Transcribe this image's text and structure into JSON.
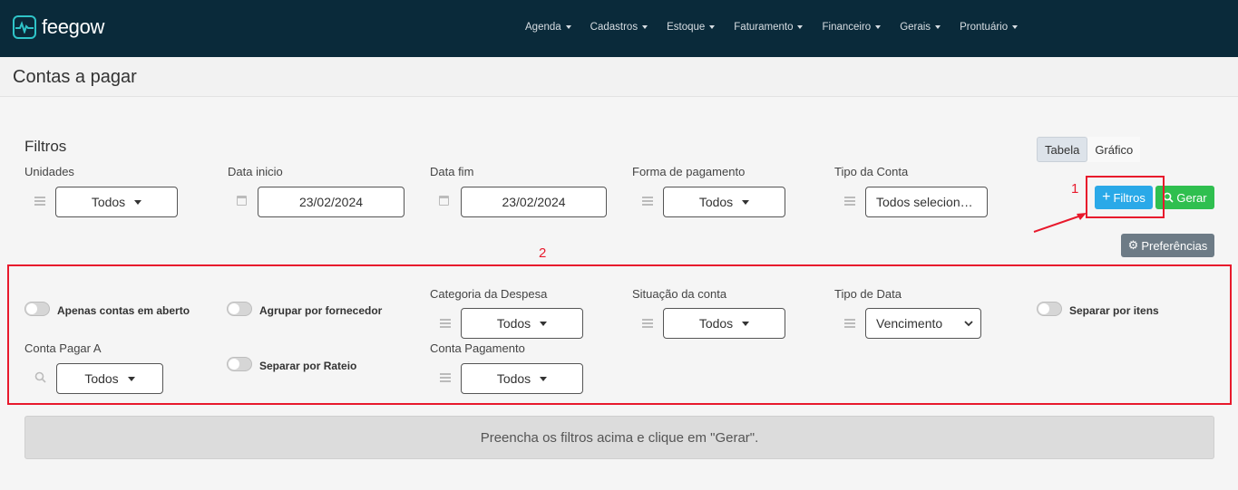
{
  "app": {
    "logo_text": "feegow"
  },
  "nav": [
    {
      "label": "Agenda"
    },
    {
      "label": "Cadastros"
    },
    {
      "label": "Estoque"
    },
    {
      "label": "Faturamento"
    },
    {
      "label": "Financeiro"
    },
    {
      "label": "Gerais"
    },
    {
      "label": "Prontuário"
    }
  ],
  "page": {
    "title": "Contas a pagar"
  },
  "filters": {
    "title": "Filtros",
    "unidades": {
      "label": "Unidades",
      "value": "Todos"
    },
    "data_inicio": {
      "label": "Data inicio",
      "value": "23/02/2024"
    },
    "data_fim": {
      "label": "Data fim",
      "value": "23/02/2024"
    },
    "forma_pagamento": {
      "label": "Forma de pagamento",
      "value": "Todos"
    },
    "tipo_conta": {
      "label": "Tipo da Conta",
      "value": "Todos selecion…"
    }
  },
  "view_toggle": {
    "tabela": "Tabela",
    "grafico": "Gráfico"
  },
  "buttons": {
    "filtros": "Filtros",
    "gerar": "Gerar",
    "preferencias": "Preferências"
  },
  "annotations": {
    "one": "1",
    "two": "2"
  },
  "extra_filters": {
    "apenas_abertas": "Apenas contas em aberto",
    "agrupar_fornecedor": "Agrupar por fornecedor",
    "categoria": {
      "label": "Categoria da Despesa",
      "value": "Todos"
    },
    "situacao": {
      "label": "Situação da conta",
      "value": "Todos"
    },
    "tipo_data": {
      "label": "Tipo de Data",
      "value": "Vencimento"
    },
    "separar_itens": "Separar por itens",
    "conta_pagar_a": {
      "label": "Conta Pagar A",
      "value": "Todos"
    },
    "separar_rateio": "Separar por Rateio",
    "conta_pagamento": {
      "label": "Conta Pagamento",
      "value": "Todos"
    }
  },
  "notice": "Preencha os filtros acima e clique em \"Gerar\".",
  "colors": {
    "topbar": "#0a2a3a",
    "accent_blue": "#2aa9e8",
    "accent_green": "#2fbf4f",
    "annotation_red": "#e8192c"
  }
}
